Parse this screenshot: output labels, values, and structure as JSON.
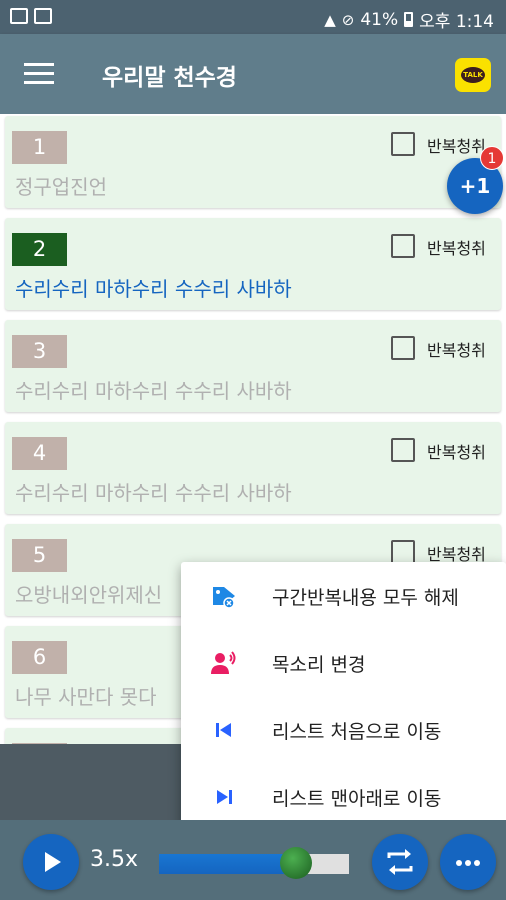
{
  "status_bar": {
    "battery": "41%",
    "time": "오후 1:14",
    "left_icons": [
      "image-icon",
      "gmail-icon"
    ],
    "right_icons": [
      "wifi-icon",
      "do-not-disturb-icon",
      "battery-icon"
    ]
  },
  "app_bar": {
    "title": "우리말 천수경",
    "menu_icon": "hamburger-icon",
    "action_icon": "kakaotalk-icon",
    "kakao_text": "TALK"
  },
  "list": {
    "repeat_label": "반복청취",
    "items": [
      {
        "number": "1",
        "text": "정구업진언",
        "active": false
      },
      {
        "number": "2",
        "text": "수리수리 마하수리 수수리 사바하",
        "active": true
      },
      {
        "number": "3",
        "text": "수리수리 마하수리 수수리 사바하",
        "active": false
      },
      {
        "number": "4",
        "text": "수리수리 마하수리 수수리 사바하",
        "active": false
      },
      {
        "number": "5",
        "text": "오방내외안위제신",
        "active": false
      },
      {
        "number": "6",
        "text": "나무 사만다 못다",
        "active": false
      }
    ]
  },
  "fab": {
    "label": "+1",
    "badge": "1"
  },
  "menu": {
    "items": [
      {
        "label": "구간반복내용 모두 해제",
        "icon": "tag-clear-icon",
        "color": "#1e88e5"
      },
      {
        "label": "목소리 변경",
        "icon": "voice-icon",
        "color": "#e91e63"
      },
      {
        "label": "리스트 처음으로 이동",
        "icon": "skip-first-icon",
        "color": "#2962ff"
      },
      {
        "label": "리스트 맨아래로 이동",
        "icon": "skip-last-icon",
        "color": "#2962ff"
      }
    ]
  },
  "controls": {
    "speed": "3.5x",
    "progress": 0.72,
    "play_icon": "play-icon",
    "repeat_icon": "repeat-icon",
    "more_icon": "more-icon"
  },
  "colors": {
    "status_bar": "#4c6270",
    "app_bar": "#607d8b",
    "card_bg": "#e8f5e9",
    "number_inactive": "#c1b1aa",
    "number_active": "#1b5e20",
    "text_active": "#1565c0",
    "text_inactive": "#b0b0b0",
    "accent": "#1565c0"
  }
}
